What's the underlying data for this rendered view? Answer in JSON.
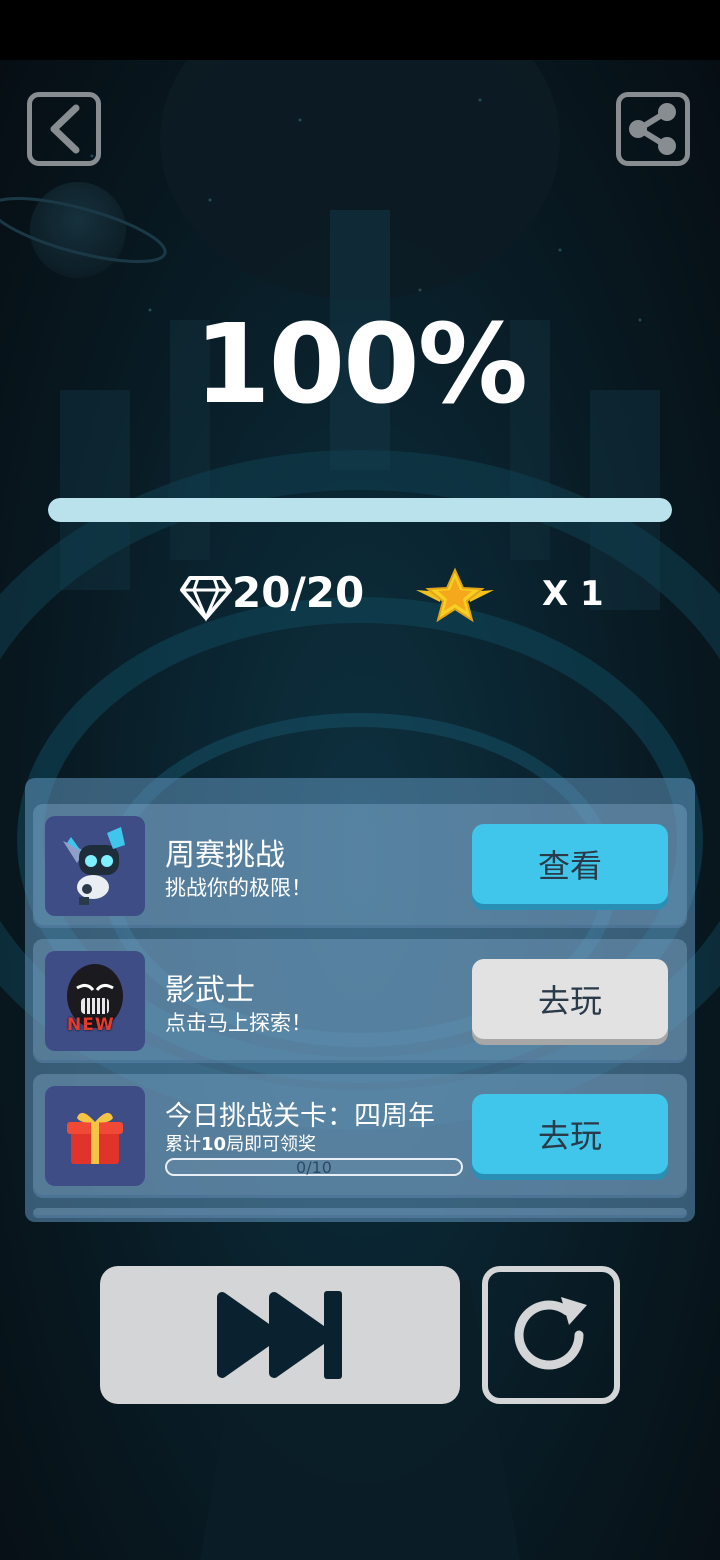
{
  "header": {
    "back_icon": "back-arrow-icon",
    "share_icon": "share-icon"
  },
  "result": {
    "percent": "100%",
    "progress": 1.0,
    "gems": "20/20",
    "gem_icon": "diamond-icon",
    "star_icon": "winged-star-icon",
    "stars": "X 1"
  },
  "panel": {
    "items": [
      {
        "title": "周赛挑战",
        "subtitle": "挑战你的极限！",
        "button": "查看",
        "thumb_icon": "robot-character-icon",
        "button_color": "#3fc6ea"
      },
      {
        "title": "影武士",
        "subtitle": "点击马上探索！",
        "button": "去玩",
        "thumb_icon": "shadow-samurai-new-icon",
        "badge": "NEW",
        "button_color": "#e2e2e2"
      },
      {
        "title": "今日挑战关卡：四周年",
        "subtitle_prefix": "累计",
        "subtitle_num": "10",
        "subtitle_suffix": "局即可领奖",
        "progress_text": "0/10",
        "progress": 0,
        "button": "去玩",
        "thumb_icon": "gift-box-icon",
        "button_color": "#3fc6ea"
      }
    ]
  },
  "footer": {
    "skip_icon": "fast-forward-icon",
    "replay_icon": "replay-icon"
  },
  "colors": {
    "accent_blue": "#3fc6ea",
    "progress_fill": "#b9e2ec",
    "panel_bg": "#6096be"
  }
}
